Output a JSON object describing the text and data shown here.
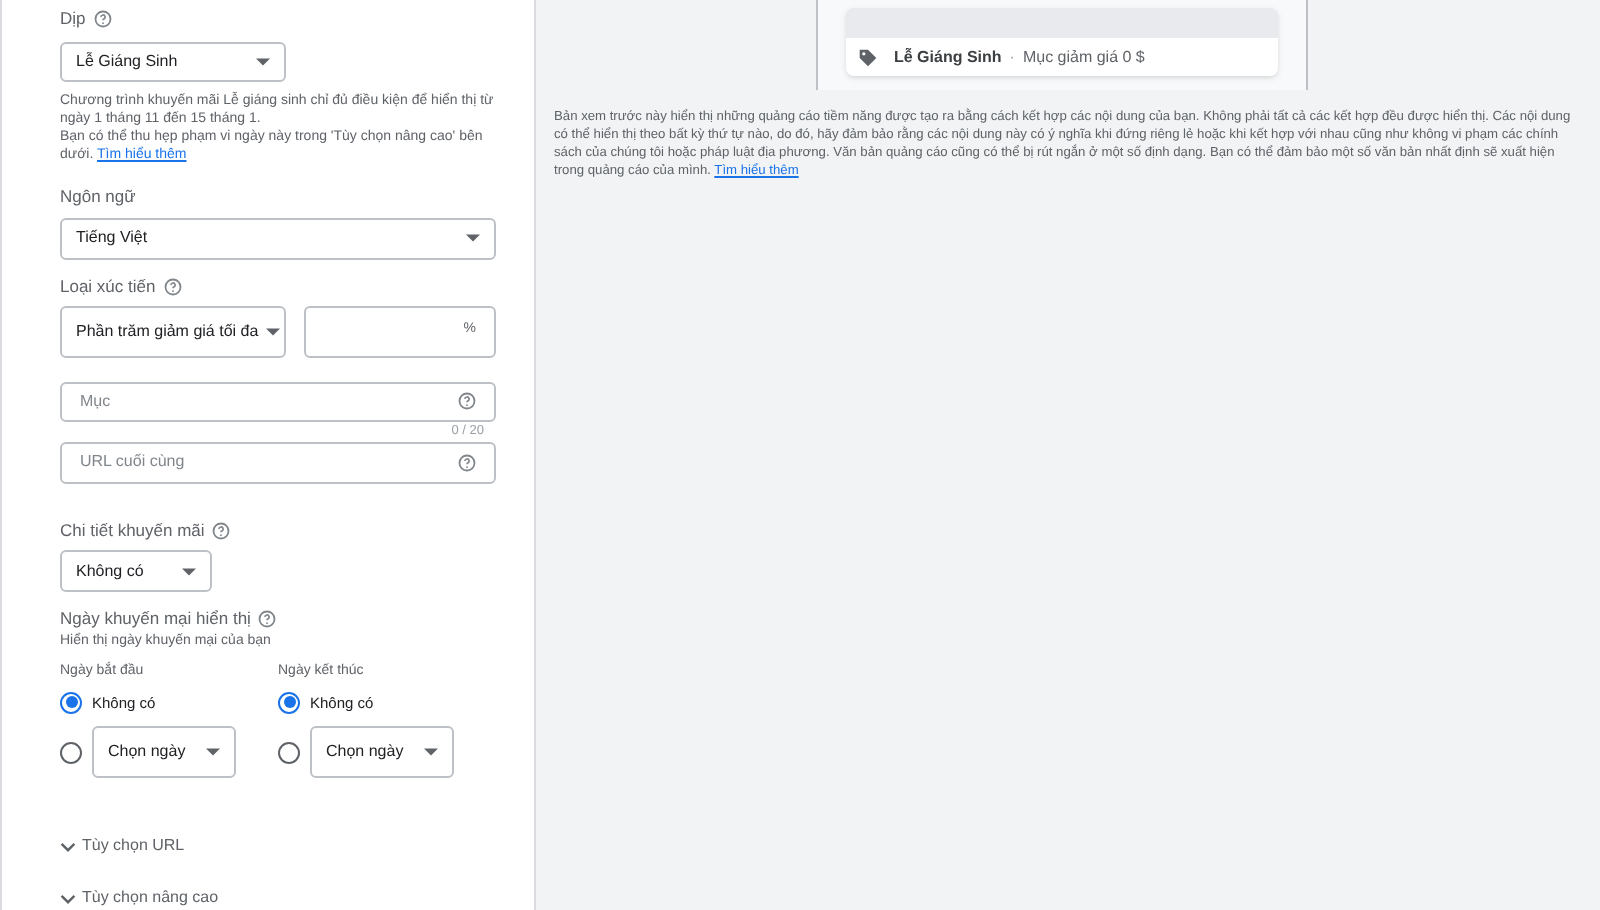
{
  "form": {
    "occasion": {
      "label": "Dịp",
      "value": "Lễ Giáng Sinh",
      "help": "Chương trình khuyến mãi Lễ giáng sinh chỉ đủ điều kiện để hiển thị từ ngày 1 tháng 11 đến 15 tháng 1.",
      "help_2": "Bạn có thể thu hẹp phạm vi ngày này trong 'Tùy chọn nâng cao' bên dưới.",
      "help_link": "Tìm hiểu thêm"
    },
    "language": {
      "label": "Ngôn ngữ",
      "value": "Tiếng Việt"
    },
    "promotion_type": {
      "label": "Loại xúc tiến",
      "value": "Phần trăm giảm giá tối đa",
      "suffix": "%"
    },
    "item": {
      "placeholder": "Mục",
      "counter": "0 / 20"
    },
    "final_url": {
      "placeholder": "URL cuối cùng"
    },
    "promotion_details": {
      "label": "Chi tiết khuyến mãi",
      "value": "Không có"
    },
    "display_dates": {
      "label": "Ngày khuyến mại hiển thị",
      "sublabel": "Hiển thị ngày khuyến mại của bạn",
      "columns": [
        {
          "label": "Ngày bắt đầu",
          "options": [
            {
              "kind": "text",
              "label": "Không có",
              "selected": true
            },
            {
              "kind": "dropdown",
              "label": "Chọn ngày",
              "selected": false
            }
          ]
        },
        {
          "label": "Ngày kết thúc",
          "options": [
            {
              "kind": "text",
              "label": "Không có",
              "selected": true
            },
            {
              "kind": "dropdown",
              "label": "Chọn ngày",
              "selected": false
            }
          ]
        }
      ]
    },
    "expanders": [
      {
        "label": "Tùy chọn URL",
        "expanded": false
      },
      {
        "label": "Tùy chọn nâng cao",
        "expanded": false
      }
    ]
  },
  "preview": {
    "title": "Lễ Giáng Sinh",
    "separator": "·",
    "detail": "Mục giảm giá 0 $",
    "note": "Bản xem trước này hiển thị những quảng cáo tiềm năng được tạo ra bằng cách kết hợp các nội dung của bạn. Không phải tất cả các kết hợp đều được hiển thị. Các nội dung có thể hiển thị theo bất kỳ thứ tự nào, do đó, hãy đảm bảo rằng các nội dung này có ý nghĩa khi đứng riêng lẻ hoặc khi kết hợp với nhau cũng như không vi phạm các chính sách của chúng tôi hoặc pháp luật địa phương. Văn bản quảng cáo cũng có thể bị rút ngắn ở một số định dạng. Bạn có thể đảm bảo một số văn bản nhất định sẽ xuất hiện trong quảng cáo của mình.",
    "note_link": "Tìm hiểu thêm"
  }
}
